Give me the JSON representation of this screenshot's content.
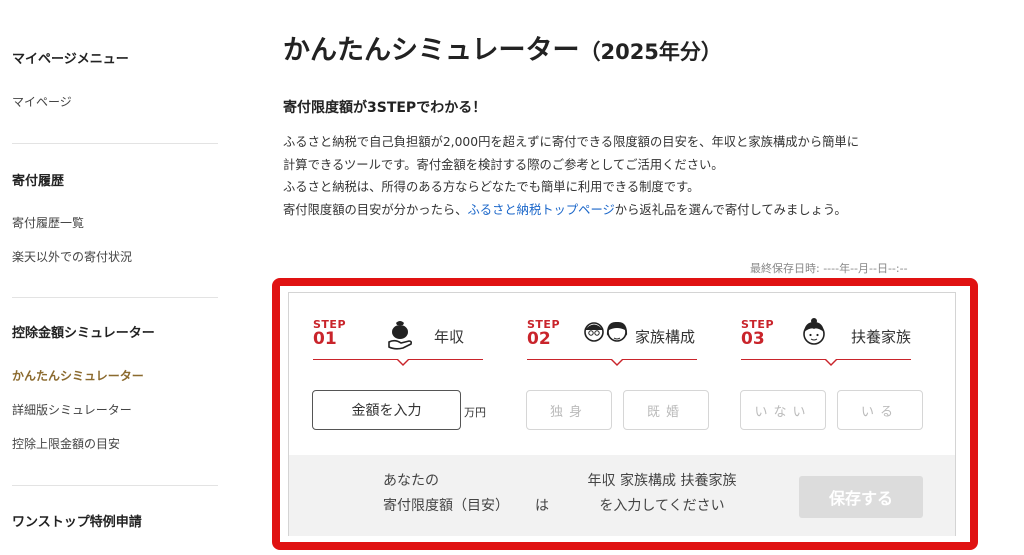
{
  "sidebar": {
    "mypage_menu_heading": "マイページメニュー",
    "mypage_link": "マイページ",
    "donation_history_heading": "寄付履歴",
    "donation_history_list": "寄付履歴一覧",
    "non_rakuten_status": "楽天以外での寄付状況",
    "deduction_simulator_heading": "控除金額シミュレーター",
    "easy_simulator": "かんたんシミュレーター",
    "detailed_simulator": "詳細版シミュレーター",
    "deduction_limit_guide": "控除上限金額の目安",
    "one_stop_heading": "ワンストップ特例申請"
  },
  "main": {
    "title": "かんたんシミュレーター",
    "title_year": "（2025年分）",
    "subheading": "寄付限度額が3STEPでわかる！",
    "desc_line1": "ふるさと納税で自己負担額が2,000円を超えずに寄付できる限度額の目安を、年収と家族構成から簡単に",
    "desc_line2": "計算できるツールです。寄付金額を検討する際のご参考としてご活用ください。",
    "desc_line3": "ふるさと納税は、所得のある方ならどなたでも簡単に利用できる制度です。",
    "desc_line4_pre": "寄付限度額の目安が分かったら、",
    "desc_line4_link": "ふるさと納税トップページ",
    "desc_line4_post": "から返礼品を選んで寄付してみましょう。",
    "last_saved": "最終保存日時: ----年--月--日--:--"
  },
  "simulator": {
    "steps": [
      {
        "step_word": "STEP",
        "number": "01",
        "label": "年収",
        "icon": "money-bag-hand-icon"
      },
      {
        "step_word": "STEP",
        "number": "02",
        "label": "家族構成",
        "icon": "couple-icon"
      },
      {
        "step_word": "STEP",
        "number": "03",
        "label": "扶養家族",
        "icon": "child-icon"
      }
    ],
    "amount_button": "金額を入力",
    "amount_unit": "万円",
    "single_button": "独身",
    "married_button": "既婚",
    "none_button": "いない",
    "have_button": "いる",
    "result_left_line1": "あなたの",
    "result_left_line2": "寄付限度額（目安）",
    "result_left_suffix": "は",
    "result_center_line1": "年収 家族構成 扶養家族",
    "result_center_line2": "を入力してください",
    "save_button": "保存する"
  },
  "colors": {
    "accent_red": "#c9242b",
    "highlight_frame": "#e01212",
    "active_link": "#8b6a2e",
    "link_blue": "#1a66c9"
  }
}
